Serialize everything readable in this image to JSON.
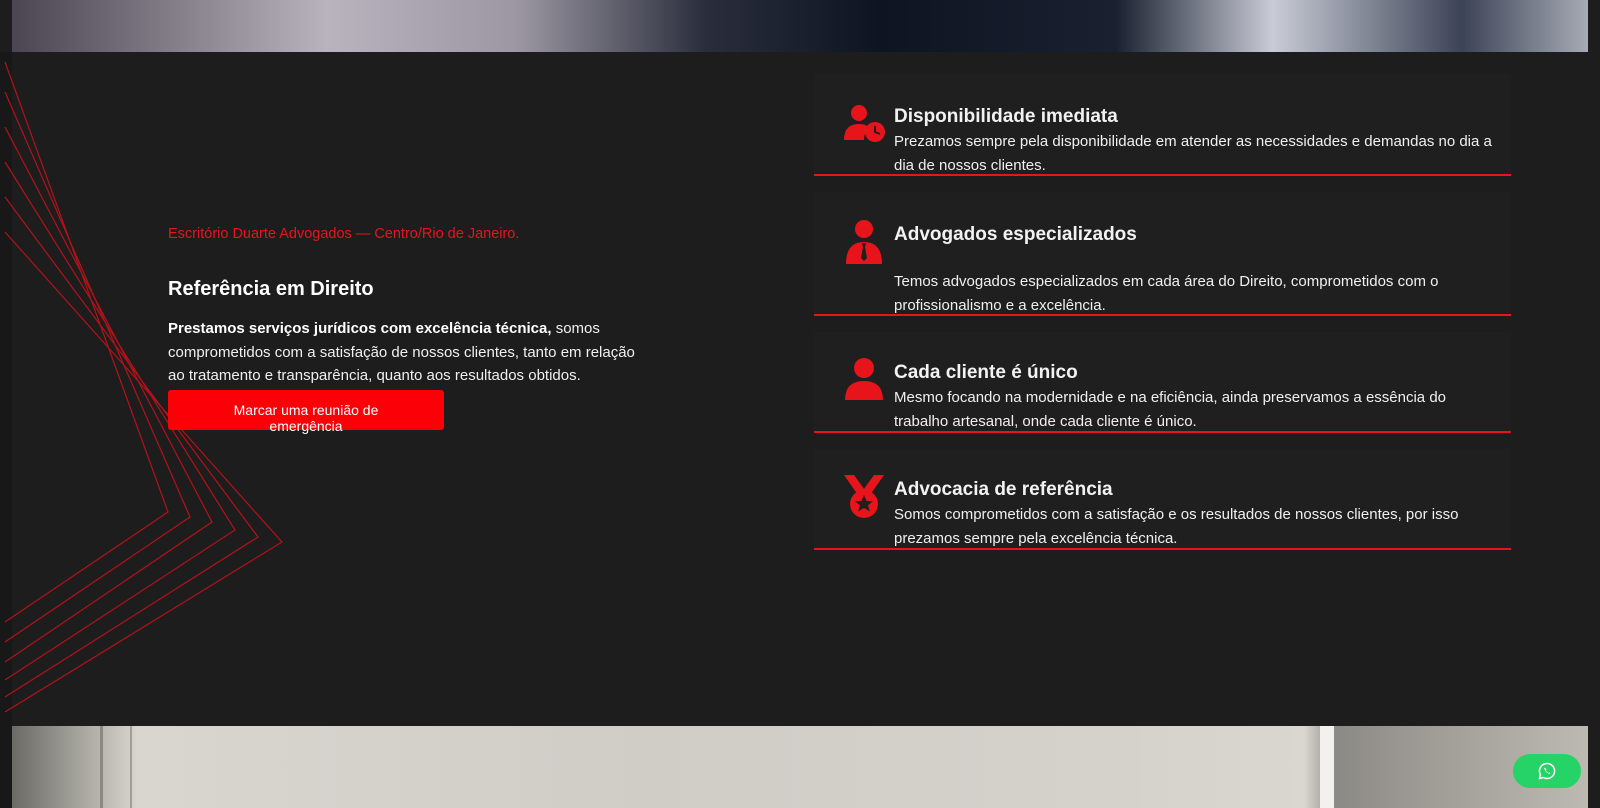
{
  "hero": {
    "eyebrow": "Escritório Duarte Advogados — Centro/Rio de Janeiro.",
    "heading": "Referência em Direito",
    "description_bold": "Prestamos serviços jurídicos com excelência técnica,",
    "description_rest": " somos comprometidos com a satisfação de nossos clientes, tanto em relação ao tratamento e transparência, quanto aos resultados obtidos.",
    "cta_label": "Marcar uma reunião de emergência"
  },
  "features": [
    {
      "icon": "user-clock-icon",
      "title": "Disponibilidade imediata",
      "text": "Prezamos sempre pela disponibilidade em atender as necessidades e demandas no dia a dia de nossos clientes."
    },
    {
      "icon": "user-tie-icon",
      "title": "Advogados especializados",
      "text": "Temos advogados especializados em cada área do Direito, comprometidos com o profissionalismo e a excelência."
    },
    {
      "icon": "user-icon",
      "title": "Cada cliente é único",
      "text": "Mesmo focando na modernidade e na eficiência, ainda preservamos a essência do trabalho artesanal, onde cada cliente é único."
    },
    {
      "icon": "medal-icon",
      "title": "Advocacia de referência",
      "text": "Somos comprometidos com a satisfação e os resultados de nossos clientes, por isso prezamos sempre pela excelência técnica."
    }
  ],
  "colors": {
    "accent": "#e8141c",
    "button": "#fb0007",
    "background": "#1d1d1d",
    "whatsapp": "#25d366"
  },
  "whatsapp_icon": "whatsapp-icon"
}
